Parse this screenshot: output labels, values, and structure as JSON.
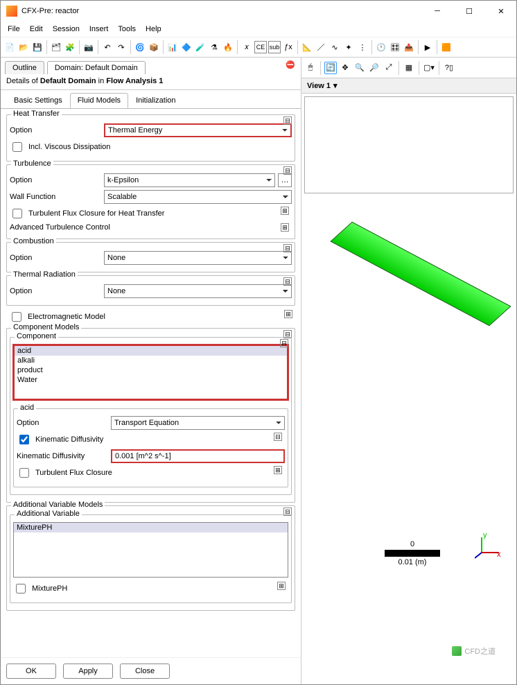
{
  "title": "CFX-Pre:  reactor",
  "menu": [
    "File",
    "Edit",
    "Session",
    "Insert",
    "Tools",
    "Help"
  ],
  "docTabs": {
    "outline": "Outline",
    "domain": "Domain: Default Domain"
  },
  "detailsHeader": {
    "prefix": "Details of ",
    "domain": "Default Domain",
    "mid": " in ",
    "analysis": "Flow Analysis 1"
  },
  "subTabs": [
    "Basic Settings",
    "Fluid Models",
    "Initialization"
  ],
  "heatTransfer": {
    "title": "Heat Transfer",
    "optionLabel": "Option",
    "optionValue": "Thermal Energy",
    "viscousLabel": "Incl. Viscous Dissipation"
  },
  "turbulence": {
    "title": "Turbulence",
    "optionLabel": "Option",
    "optionValue": "k-Epsilon",
    "wallLabel": "Wall Function",
    "wallValue": "Scalable",
    "fluxLabel": "Turbulent Flux Closure for Heat Transfer",
    "advLabel": "Advanced Turbulence Control"
  },
  "combustion": {
    "title": "Combustion",
    "optionLabel": "Option",
    "optionValue": "None"
  },
  "thermalRad": {
    "title": "Thermal Radiation",
    "optionLabel": "Option",
    "optionValue": "None"
  },
  "emModel": {
    "label": "Electromagnetic Model"
  },
  "compModels": {
    "title": "Component Models",
    "compTitle": "Component",
    "items": [
      "acid",
      "alkali",
      "product",
      "Water"
    ],
    "selName": "acid",
    "optionLabel": "Option",
    "optionValue": "Transport Equation",
    "kinDiffCheck": "Kinematic Diffusivity",
    "kinDiffLabel": "Kinematic Diffusivity",
    "kinDiffValue": "0.001 [m^2 s^-1]",
    "turbFlux": "Turbulent Flux Closure"
  },
  "addVar": {
    "title": "Additional Variable Models",
    "sub": "Additional Variable",
    "item": "MixturePH",
    "check": "MixturePH"
  },
  "buttons": {
    "ok": "OK",
    "apply": "Apply",
    "close": "Close"
  },
  "view": {
    "label": "View 1"
  },
  "scale": {
    "zero": "0",
    "val": "0.01  (m)"
  },
  "watermark": "CFD之道"
}
